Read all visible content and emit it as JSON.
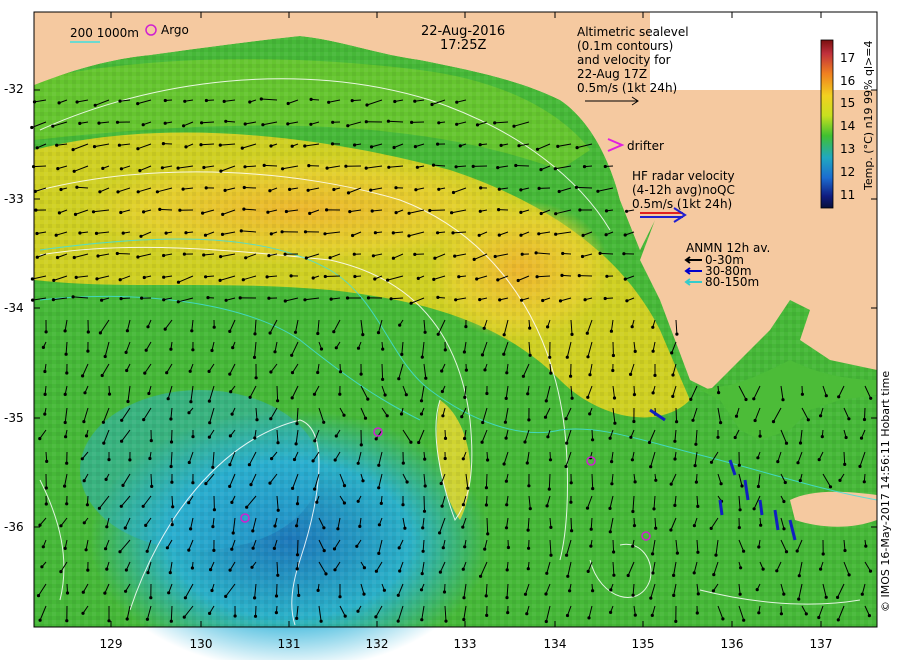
{
  "header": {
    "date": "22-Aug-2016",
    "time": "17:25Z"
  },
  "legend": {
    "bathymetry": "200  1000m",
    "argo": "Argo",
    "drifter": "drifter",
    "altimetry": [
      "Altimetric sealevel",
      "(0.1m contours)",
      "and velocity for",
      "22-Aug 17Z",
      "0.5m/s (1kt 24h)"
    ],
    "hf_radar": [
      "HF radar velocity",
      "(4-12h avg)noQC",
      "0.5m/s (1kt 24h)"
    ],
    "anmn": {
      "title": "ANMN 12h av.",
      "items": [
        {
          "label": "0-30m",
          "color": "#000000"
        },
        {
          "label": "30-80m",
          "color": "#0000cc"
        },
        {
          "label": "80-150m",
          "color": "#33cccc"
        }
      ]
    }
  },
  "colorbar": {
    "label": "Temp. (°C) n19 99% ql>=4",
    "ticks": [
      "17",
      "16",
      "15",
      "14",
      "13",
      "12",
      "11"
    ]
  },
  "axes": {
    "lat_ticks": [
      "-32",
      "-33",
      "-34",
      "-35",
      "-36"
    ],
    "lon_ticks": [
      "129",
      "130",
      "131",
      "132",
      "133",
      "134",
      "135",
      "136",
      "137"
    ]
  },
  "credit": "© IMOS 16-May-2017 14:56:11 Hobart time",
  "colors": {
    "land": "#f5c9a0",
    "warm": "#f2b02c",
    "cool": "#2bb0e0",
    "mid": "#4cc02c"
  }
}
